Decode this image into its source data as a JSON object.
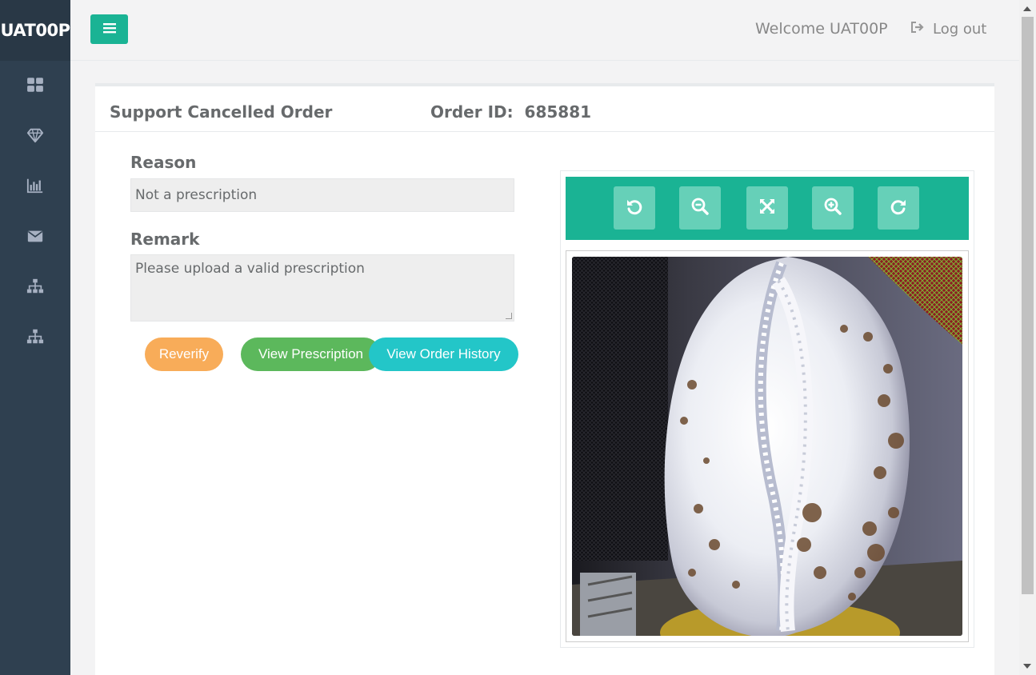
{
  "brand": "UAT00P",
  "sidebar": {
    "items": [
      {
        "icon": "dashboard-icon"
      },
      {
        "icon": "diamond-icon"
      },
      {
        "icon": "bar-chart-icon"
      },
      {
        "icon": "envelope-icon"
      },
      {
        "icon": "sitemap-icon"
      },
      {
        "icon": "sitemap-icon"
      }
    ]
  },
  "topbar": {
    "welcome": "Welcome UAT00P",
    "logout": "Log out"
  },
  "panel": {
    "title": "Support Cancelled Order",
    "order_label": "Order ID:  685881"
  },
  "form": {
    "reason_label": "Reason",
    "reason_value": "Not a prescription",
    "remark_label": "Remark",
    "remark_value": "Please upload a valid prescription"
  },
  "buttons": {
    "reverify": "Reverify",
    "view_prescription": "View Prescription",
    "view_order_history": "View Order History"
  },
  "viewer": {
    "tools": [
      "rotate-left-icon",
      "zoom-out-icon",
      "fit-screen-icon",
      "zoom-in-icon",
      "rotate-right-icon"
    ]
  },
  "colors": {
    "sidebar": "#2f4050",
    "primary": "#1ab394",
    "warning": "#f8ac59",
    "success": "#5cb85c",
    "info": "#23c6c8"
  }
}
